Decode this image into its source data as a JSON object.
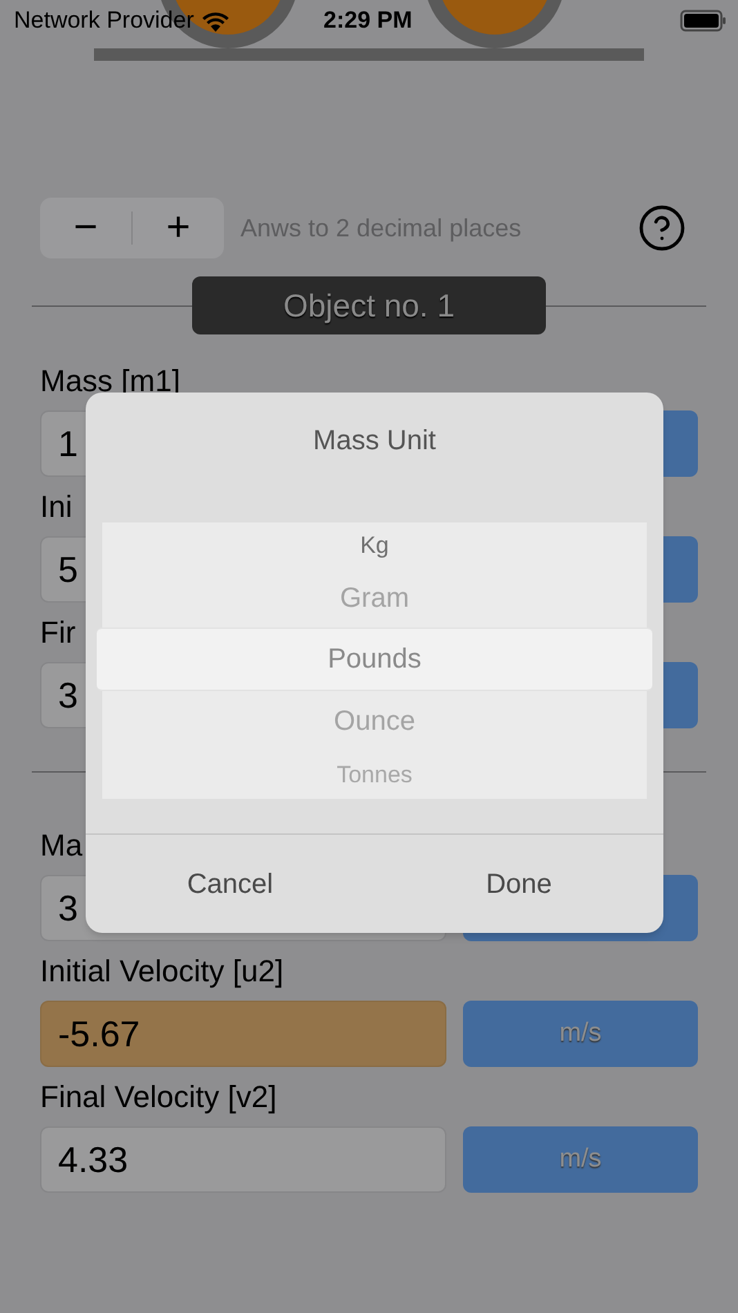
{
  "status_bar": {
    "carrier": "Network Provider",
    "time": "2:29 PM"
  },
  "precision": {
    "minus": "−",
    "plus": "+",
    "hint": "Anws to 2 decimal places"
  },
  "sections": [
    {
      "heading": "Object no. 1",
      "rows": [
        {
          "label": "Mass [m1]",
          "value": "1",
          "highlighted": false
        },
        {
          "label": "Ini",
          "value": "5",
          "highlighted": false
        },
        {
          "label": "Fir",
          "value": "3",
          "highlighted": false
        }
      ]
    },
    {
      "rows": [
        {
          "label": "Ma",
          "value": "3",
          "highlighted": false
        },
        {
          "label": "Initial Velocity [u2]",
          "value": "-5.67",
          "unit": "m/s",
          "highlighted": true
        },
        {
          "label": "Final Velocity [v2]",
          "value": "4.33",
          "unit": "m/s",
          "highlighted": false
        }
      ]
    }
  ],
  "dialog": {
    "title": "Mass Unit",
    "options": [
      {
        "label": "Kg",
        "selected": false
      },
      {
        "label": "Gram",
        "selected": false
      },
      {
        "label": "Pounds",
        "selected": true
      },
      {
        "label": "Ounce",
        "selected": false
      },
      {
        "label": "Tonnes",
        "selected": false
      }
    ],
    "buttons": [
      "Cancel",
      "Done"
    ]
  }
}
